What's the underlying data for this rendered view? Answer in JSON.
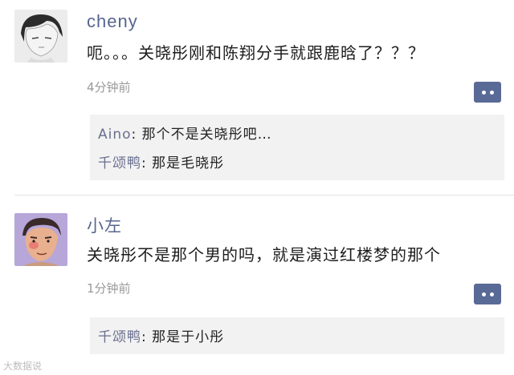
{
  "comments": [
    {
      "name": "cheny",
      "message": "呃。。。关晓彤刚和陈翔分手就跟鹿晗了？？？",
      "time": "4分钟前",
      "replies": [
        {
          "user": "Aino",
          "sep": ":",
          "text": " 那个不是关晓彤吧…"
        },
        {
          "user": "千颂鸭",
          "sep": ":",
          "text": " 那是毛晓彤"
        }
      ]
    },
    {
      "name": "小左",
      "message": "关晓彤不是那个男的吗，就是演过红楼梦的那个",
      "time": "1分钟前",
      "replies": [
        {
          "user": "千颂鸭",
          "sep": ":",
          "text": " 那是于小彤"
        }
      ]
    }
  ],
  "watermark": "大数据说",
  "colors": {
    "name": "#58658f",
    "comment_button": "#5a6a96",
    "reply_bg": "#f2f2f2"
  },
  "icons": {
    "comment": "comment-dots-icon"
  }
}
